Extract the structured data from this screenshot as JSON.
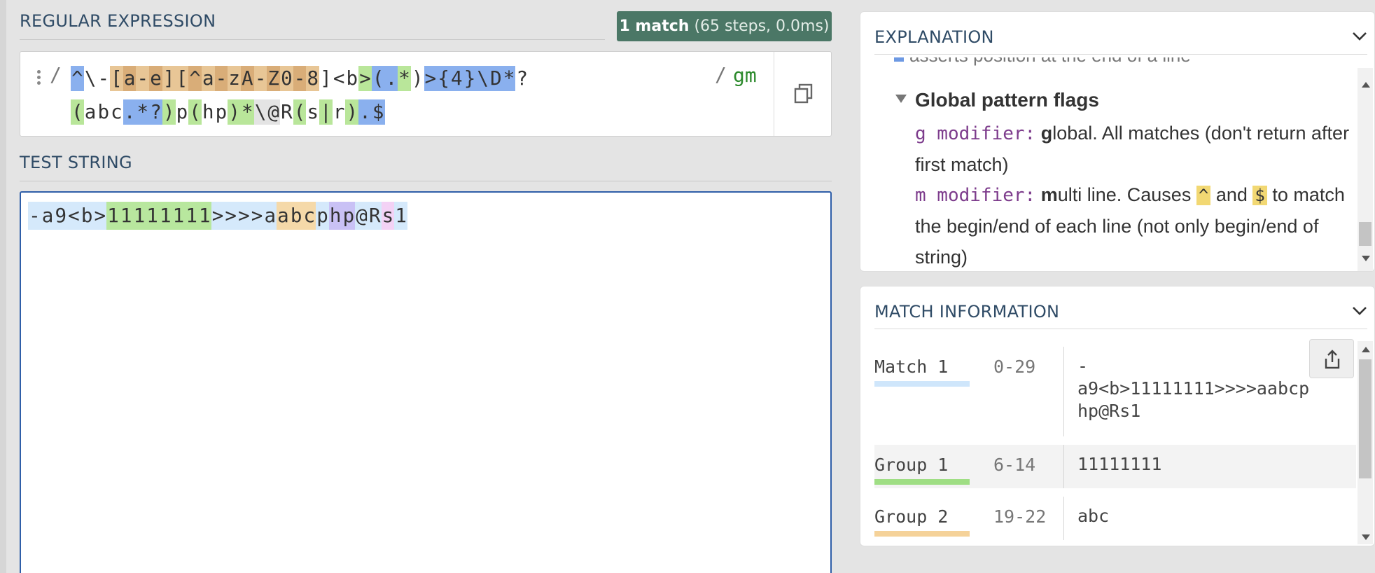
{
  "regex_panel": {
    "title": "REGULAR EXPRESSION",
    "match_summary_bold": "1 match",
    "match_summary_rest": "(65 steps, 0.0ms)",
    "delimiter_open": "/",
    "delimiter_close": "/",
    "flags": "gm",
    "line1_chars": [
      "^",
      "\\",
      "-",
      "[",
      "a",
      "-",
      "e",
      "]",
      "[",
      "^",
      "a",
      "-",
      "z",
      "A",
      "-",
      "Z",
      "0",
      "-",
      "8",
      "]",
      "<",
      "b",
      ">",
      "(",
      ".",
      "*",
      ")",
      ">",
      "{",
      "4",
      "}",
      "\\",
      "D",
      "*",
      "?"
    ],
    "line2_chars": [
      "(",
      "a",
      "b",
      "c",
      ".",
      "*",
      "?",
      ")",
      "p",
      "(",
      "h",
      "p",
      ")",
      "*",
      "\\",
      "@",
      "R",
      "(",
      "s",
      "|",
      "r",
      ")",
      ".",
      "$"
    ]
  },
  "test_panel": {
    "title": "TEST STRING",
    "chars": [
      "-",
      "a",
      "9",
      "<",
      "b",
      ">",
      "1",
      "1",
      "1",
      "1",
      "1",
      "1",
      "1",
      "1",
      ">",
      ">",
      ">",
      ">",
      "a",
      "a",
      "b",
      "c",
      "p",
      "h",
      "p",
      "@",
      "R",
      "s",
      "1"
    ]
  },
  "explanation": {
    "title": "EXPLANATION",
    "cut_line": "asserts position at the end of a line",
    "flags_heading": "Global pattern flags",
    "g_label": "g modifier:",
    "g_first": "g",
    "g_text": "lobal. All matches (don't return after first match)",
    "m_label": "m modifier:",
    "m_first": "m",
    "m_text_a": "ulti line. Causes",
    "caret": "^",
    "m_and": "and",
    "dollar": "$",
    "m_text_b": "to match the begin/end of each line (not only begin/end of string)"
  },
  "match_info": {
    "title": "MATCH INFORMATION",
    "rows": [
      {
        "name": "Match 1",
        "range": "0-29",
        "value": "-\na9<b>11111111>>>>aabcp\nhp@Rs1",
        "color": "#cfe6fb"
      },
      {
        "name": "Group 1",
        "range": "6-14",
        "value": "11111111",
        "color": "#9fde84"
      },
      {
        "name": "Group 2",
        "range": "19-22",
        "value": "abc",
        "color": "#f5d299"
      }
    ]
  },
  "colors": {
    "accent_badge": "#4b7766",
    "focus_border": "#2f5ea8",
    "section_title": "#2f4b66"
  }
}
